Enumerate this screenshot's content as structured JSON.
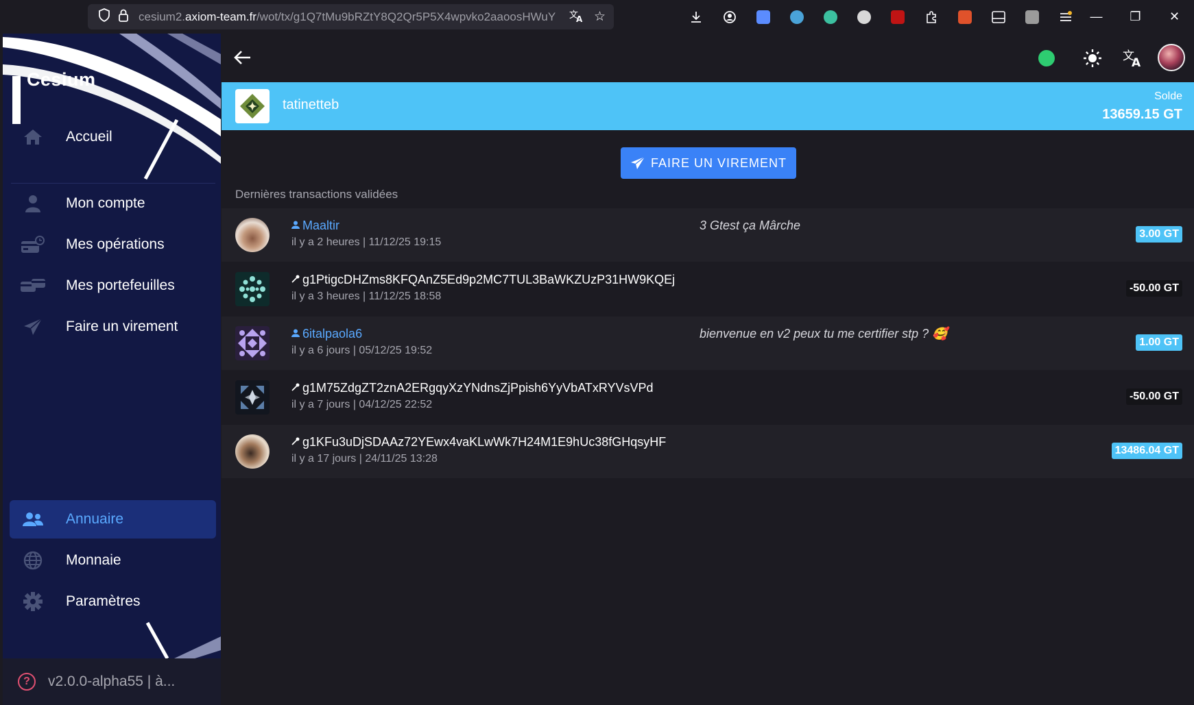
{
  "browser": {
    "url_prefix": "cesium2.",
    "url_domain": "axiom-team.fr",
    "url_path": "/wot/tx/g1Q7tMu9bRZtY8Q2Qr5P5X4wpvko2aaoosHWuY",
    "extension_colors": [
      "#5b8cff",
      "#4aa3d8",
      "#3cc0a0",
      "#d8d8d8",
      "#c01414",
      "#ffffff",
      "#e0522b",
      "#ffffff",
      "#9b9b9b",
      "#f5b72a"
    ]
  },
  "sidebar": {
    "brand": "Cesium",
    "items": [
      {
        "label": "Accueil",
        "icon": "home-icon"
      },
      {
        "label": "Mon compte",
        "icon": "user-icon"
      },
      {
        "label": "Mes opérations",
        "icon": "card-history-icon"
      },
      {
        "label": "Mes portefeuilles",
        "icon": "wallets-icon"
      },
      {
        "label": "Faire un virement",
        "icon": "send-icon"
      },
      {
        "label": "Annuaire",
        "icon": "people-icon",
        "active": true
      },
      {
        "label": "Monnaie",
        "icon": "globe-icon"
      },
      {
        "label": "Paramètres",
        "icon": "gear-icon"
      }
    ],
    "version": "v2.0.0-alpha55 | à..."
  },
  "topbar": {
    "status_color": "#2ecc71"
  },
  "account": {
    "name": "tatinetteb",
    "balance_label": "Solde",
    "balance": "13659.15 GT"
  },
  "transfer_button": "FAIRE UN VIREMENT",
  "transactions_header": "Dernières transactions validées",
  "transactions": [
    {
      "name": "Maaltir",
      "type": "member",
      "date": "il y a 2 heures | 11/12/25 19:15",
      "comment": "3 Gtest ça Mârche",
      "amount": "3.00 GT",
      "sign": "pos"
    },
    {
      "name": "g1PtigcDHZms8KFQAnZ5Ed9p2MC7TUL3BaWKZUzP31HW9KQEj",
      "type": "key",
      "date": "il y a 3 heures | 11/12/25 18:58",
      "comment": "",
      "amount": "-50.00 GT",
      "sign": "neg"
    },
    {
      "name": "6italpaola6",
      "type": "member",
      "date": "il y a 6 jours | 05/12/25 19:52",
      "comment": "bienvenue en v2 peux tu me certifier stp ? 🥰",
      "amount": "1.00 GT",
      "sign": "pos"
    },
    {
      "name": "g1M75ZdgZT2znA2ERgqyXzYNdnsZjPpish6YyVbATxRYVsVPd",
      "type": "key",
      "date": "il y a 7 jours | 04/12/25 22:52",
      "comment": "",
      "amount": "-50.00 GT",
      "sign": "neg"
    },
    {
      "name": "g1KFu3uDjSDAAz72YEwx4vaKLwWk7H24M1E9hUc38fGHqsyHF",
      "type": "key",
      "date": "il y a 17 jours | 24/11/25 13:28",
      "comment": "",
      "amount": "13486.04 GT",
      "sign": "pos"
    }
  ]
}
